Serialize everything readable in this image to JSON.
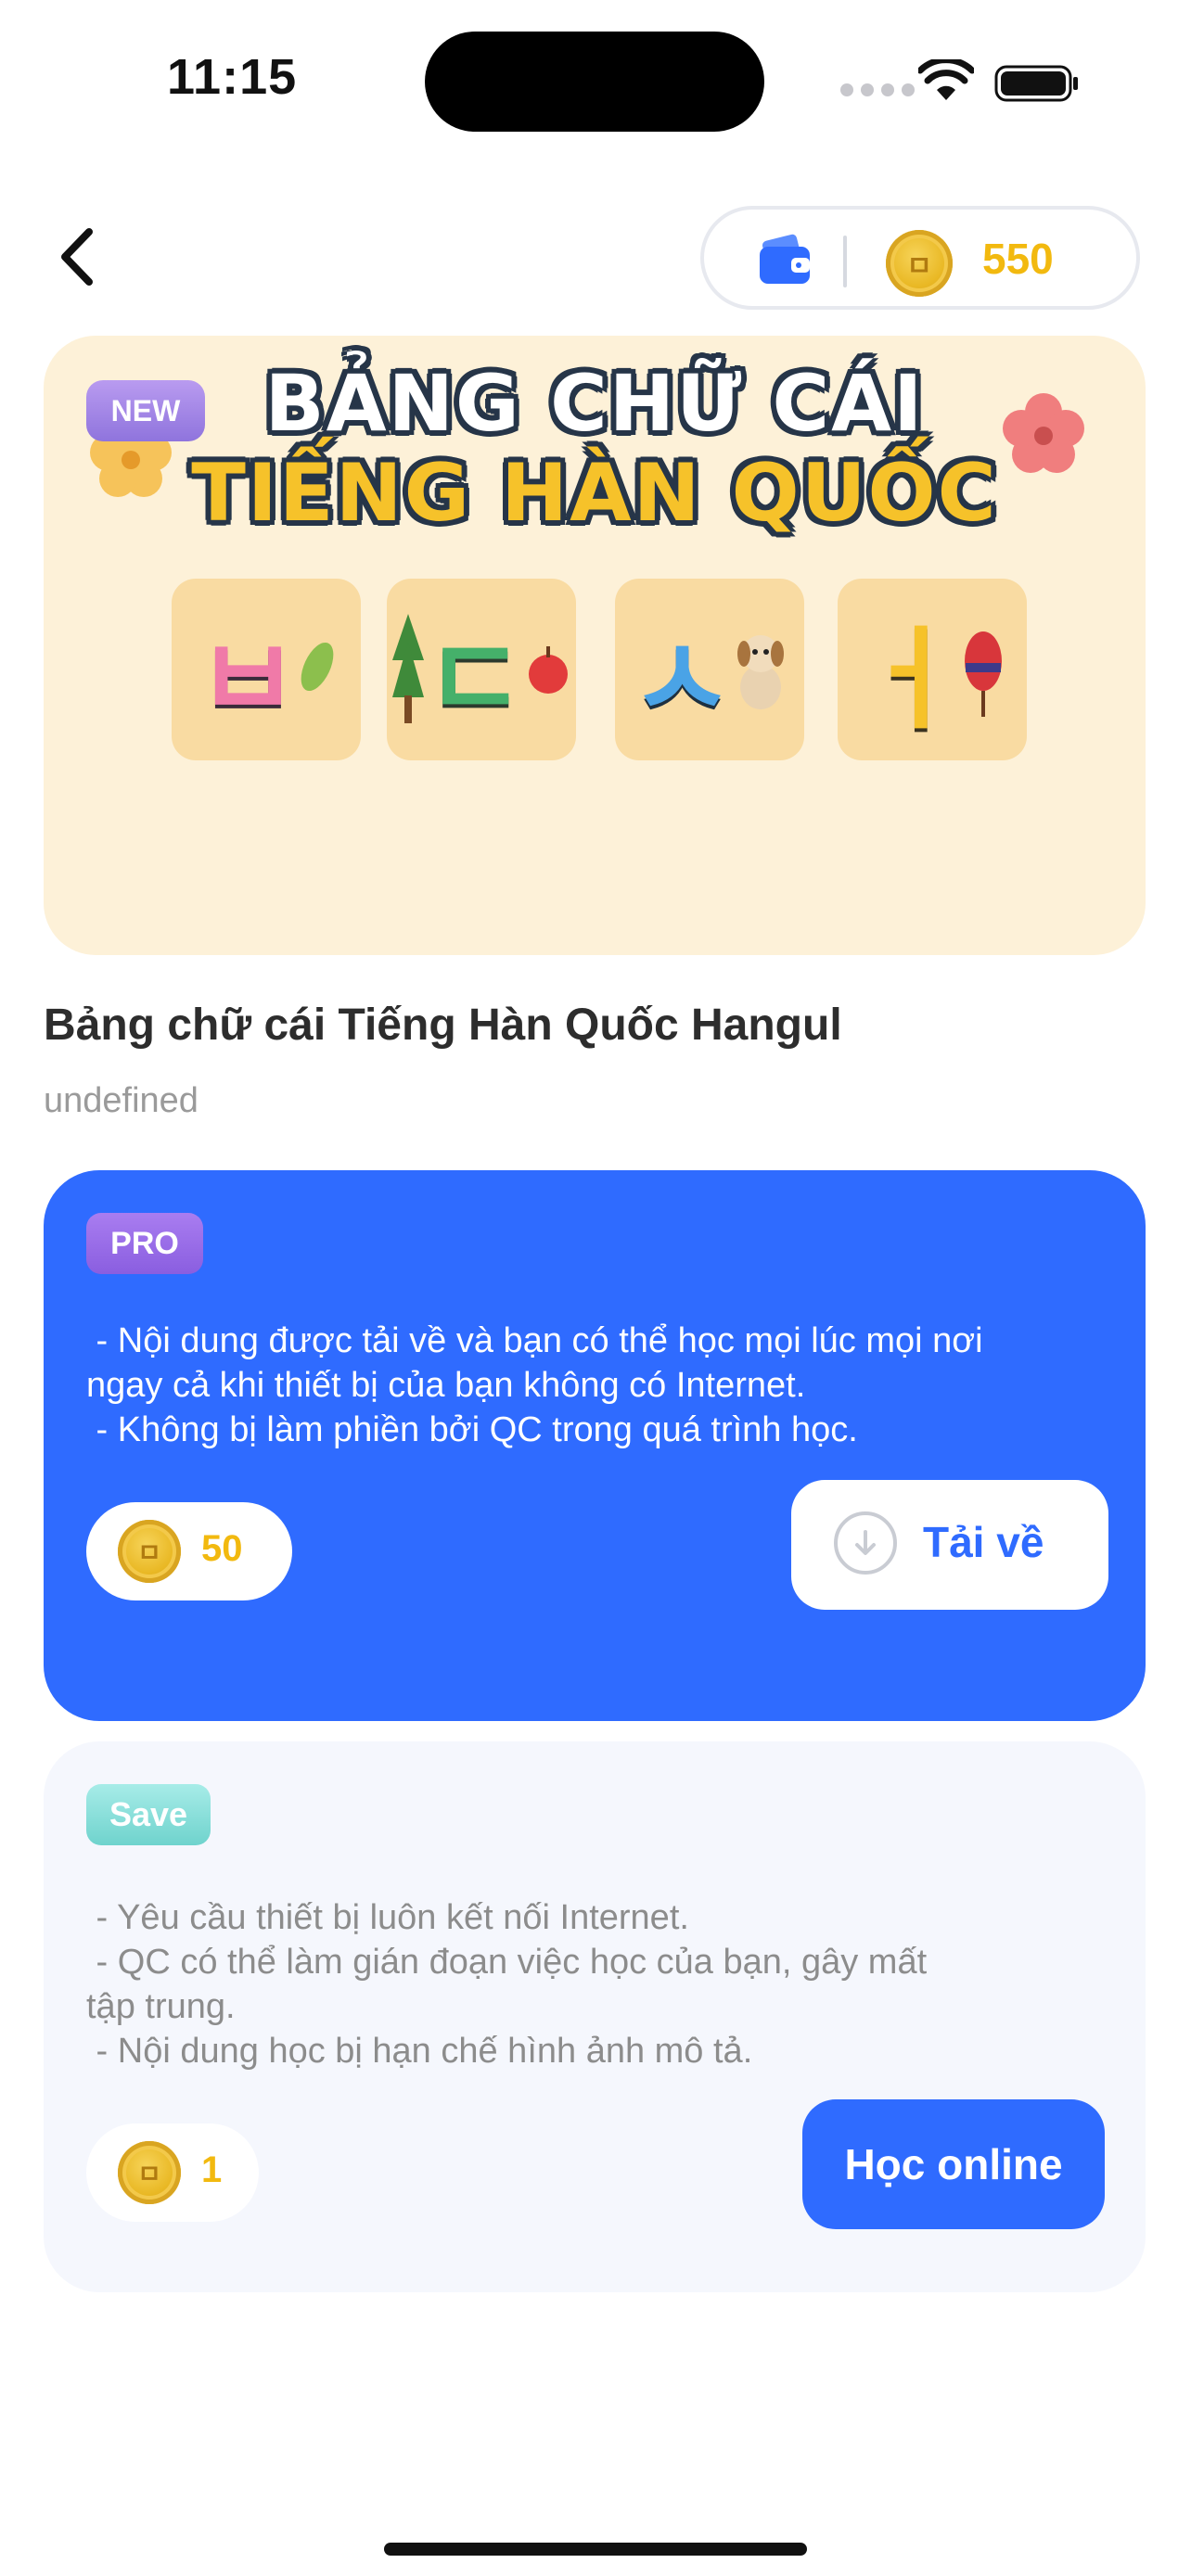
{
  "status_bar": {
    "time": "11:15"
  },
  "header": {
    "back_icon": "chevron-left-icon",
    "wallet_icon": "wallet-icon",
    "coin_symbol": "ㅁ",
    "balance": "550"
  },
  "banner": {
    "badge": "NEW",
    "title_line1": "BẢNG CHỮ CÁI",
    "title_line2": "TIẾNG HÀN QUỐC",
    "tiles": [
      "ㅂ",
      "ㄷ",
      "ㅅ",
      "ㅓ"
    ]
  },
  "course": {
    "title": "Bảng chữ cái Tiếng Hàn Quốc Hangul",
    "subtitle": "undefined"
  },
  "pro": {
    "badge": "PRO",
    "description": " - Nội dung được tải về và bạn có thể học mọi lúc mọi nơi\nngay cả khi thiết bị của bạn không có Internet.\n - Không bị làm phiền bởi QC trong quá trình học.",
    "price": "50",
    "button_label": "Tải về",
    "button_icon": "download-icon"
  },
  "save": {
    "badge": "Save",
    "description": " - Yêu cầu thiết bị luôn kết nối Internet.\n - QC có thể làm gián đoạn việc học của bạn, gây mất\ntập trung.\n - Nội dung học bị hạn chế hình ảnh mô tả.",
    "price": "1",
    "button_label": "Học online"
  },
  "colors": {
    "primary": "#2f6bff",
    "coin_text": "#f2b90f",
    "banner_bg": "#fdf1d8",
    "save_bg": "#f5f7fd"
  }
}
